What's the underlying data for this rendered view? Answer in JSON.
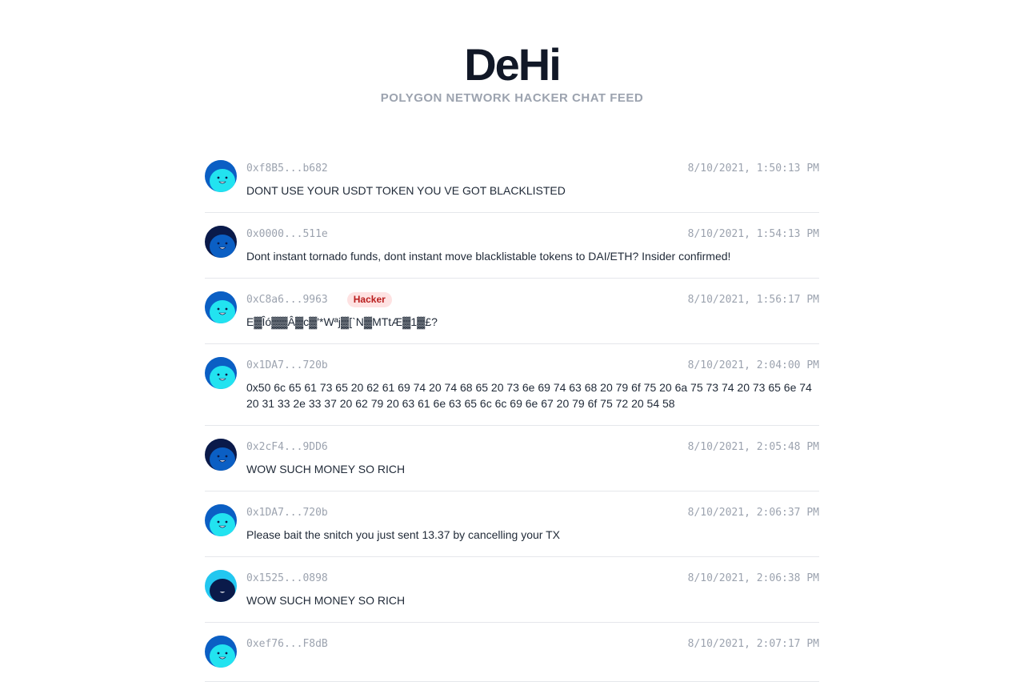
{
  "header": {
    "title": "DeHi",
    "subtitle": "POLYGON NETWORK HACKER CHAT FEED"
  },
  "colors": {
    "title": "#111827",
    "muted": "#9ca3af",
    "badge_bg": "#fee2e2",
    "badge_text": "#b91c1c",
    "divider": "#e5e7eb"
  },
  "messages": [
    {
      "address": "0xf8B5...b682",
      "badge": "",
      "timestamp": "8/10/2021, 1:50:13 PM",
      "text": "DONT USE YOUR USDT TOKEN YOU VE GOT BLACKLISTED",
      "avatar": {
        "icon": "face-avatar-icon",
        "bg": "#0b5fc4",
        "face": "#22e3f0",
        "hair": "#0b5fc4"
      }
    },
    {
      "address": "0x0000...511e",
      "badge": "",
      "timestamp": "8/10/2021, 1:54:13 PM",
      "text": "Dont instant tornado funds, dont instant move blacklistable tokens to DAI/ETH? Insider confirmed!",
      "avatar": {
        "icon": "face-avatar-icon",
        "bg": "#0a1a4a",
        "face": "#0b5fc4",
        "hair": "#0a1a4a"
      }
    },
    {
      "address": "0xC8a6...9963",
      "badge": "Hacker",
      "timestamp": "8/10/2021, 1:56:17 PM",
      "text": "E▓Îó▓▓Â▓c▓'*Wªj▓[`N▓MTtÆ▓1▓£?",
      "avatar": {
        "icon": "face-avatar-icon",
        "bg": "#0b5fc4",
        "face": "#22e3f0",
        "hair": "#0b5fc4"
      }
    },
    {
      "address": "0x1DA7...720b",
      "badge": "",
      "timestamp": "8/10/2021, 2:04:00 PM",
      "text": "0x50 6c 65 61 73 65 20 62 61 69 74 20 74 68 65 20 73 6e 69 74 63 68 20 79 6f 75 20 6a 75 73 74 20 73 65 6e 74 20 31 33 2e 33 37 20 62 79 20 63 61 6e 63 65 6c 6c 69 6e 67 20 79 6f 75 72 20 54 58",
      "avatar": {
        "icon": "face-avatar-icon",
        "bg": "#0b5fc4",
        "face": "#22e3f0",
        "hair": "#0b5fc4"
      }
    },
    {
      "address": "0x2cF4...9DD6",
      "badge": "",
      "timestamp": "8/10/2021, 2:05:48 PM",
      "text": "WOW SUCH MONEY SO RICH",
      "avatar": {
        "icon": "face-avatar-icon",
        "bg": "#0a1a4a",
        "face": "#0b5fc4",
        "hair": "#0a1a4a"
      }
    },
    {
      "address": "0x1DA7...720b",
      "badge": "",
      "timestamp": "8/10/2021, 2:06:37 PM",
      "text": "Please bait the snitch you just sent 13.37 by cancelling your TX",
      "avatar": {
        "icon": "face-avatar-icon",
        "bg": "#0b5fc4",
        "face": "#22e3f0",
        "hair": "#0b5fc4"
      }
    },
    {
      "address": "0x1525...0898",
      "badge": "",
      "timestamp": "8/10/2021, 2:06:38 PM",
      "text": "WOW SUCH MONEY SO RICH",
      "avatar": {
        "icon": "face-avatar-icon",
        "bg": "#22c7f0",
        "face": "#0a1a4a",
        "hair": "#22c7f0"
      }
    },
    {
      "address": "0xef76...F8dB",
      "badge": "",
      "timestamp": "8/10/2021, 2:07:17 PM",
      "text": "",
      "avatar": {
        "icon": "face-avatar-icon",
        "bg": "#0b5fc4",
        "face": "#22e3f0",
        "hair": "#0b5fc4"
      }
    }
  ]
}
